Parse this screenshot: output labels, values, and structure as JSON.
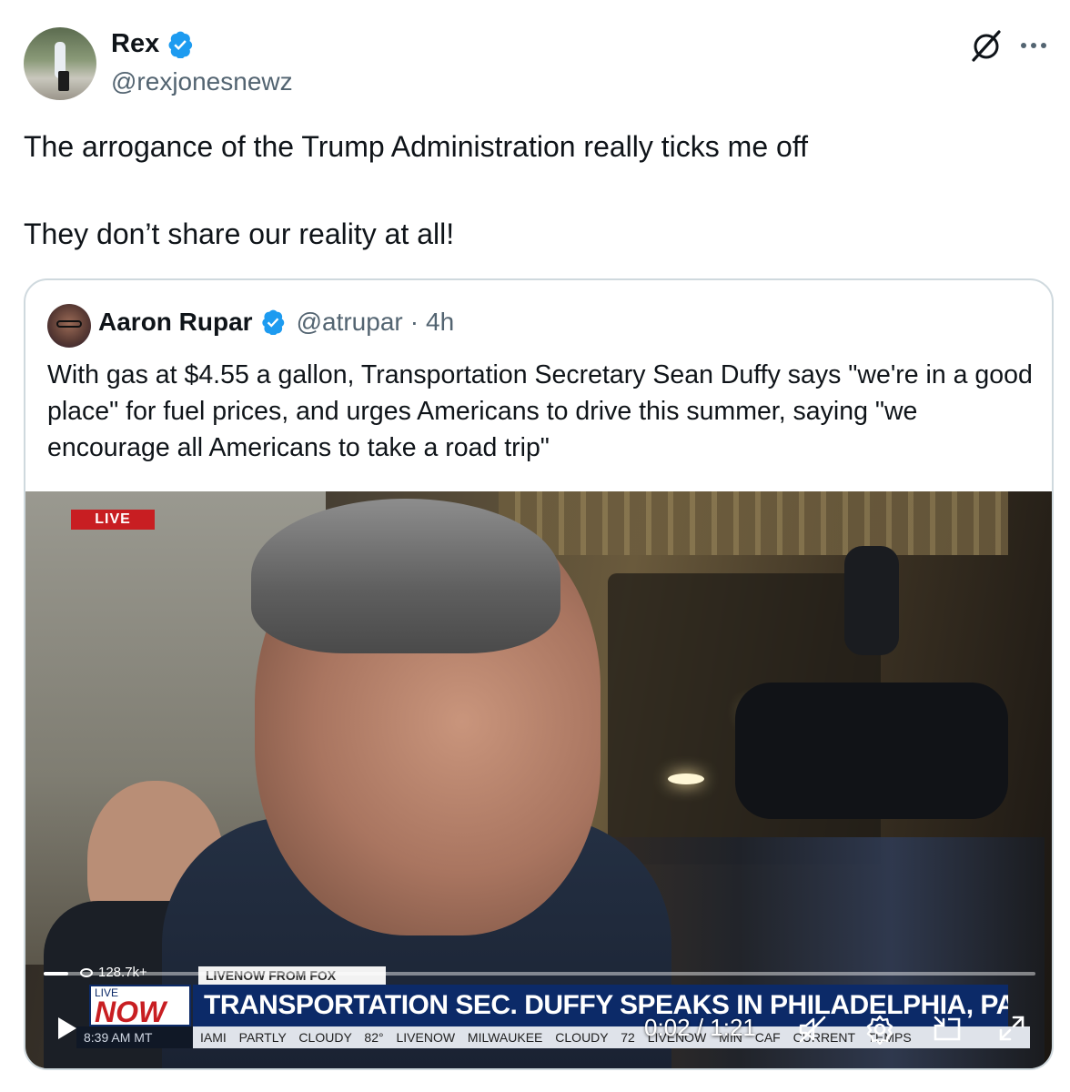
{
  "author": {
    "display_name": "Rex",
    "handle": "@rexjonesnewz",
    "verified_icon": "verified-badge-icon"
  },
  "tweet": {
    "lines": [
      "The arrogance of the Trump Administration really ticks me off",
      "They don’t share our reality at all!"
    ]
  },
  "header_icons": [
    "grok-icon",
    "more-icon"
  ],
  "quoted": {
    "display_name": "Aaron Rupar",
    "handle": "@atrupar",
    "separator": "·",
    "time": "4h",
    "text": "With gas at $4.55 a gallon, Transportation Secretary Sean Duffy says \"we're in a good place\" for fuel prices, and urges Americans to drive this summer, saying \"we encourage all Americans to take a road trip\""
  },
  "video": {
    "live_badge": "LIVE",
    "views": "128.7k+",
    "chyron_top": "LIVENOW FROM FOX",
    "live_small": "LIVE",
    "live_now": "NOW",
    "headline": "TRANSPORTATION SEC. DUFFY SPEAKS IN PHILADELPHIA, PA",
    "clock": "8:39 AM MT",
    "ticker": "IAMI PARTLY CLOUDY 82° LIVENOW MILWAUKEE CLOUDY 72 LIVENOW MIN CAF CURRENT TEMPS",
    "timecode": "0:02 / 1:21",
    "progress_fraction": 0.025,
    "controls": [
      "play-icon",
      "mute-icon",
      "gear-icon",
      "pip-icon",
      "expand-icon"
    ]
  },
  "colors": {
    "verified_blue": "#1d9bf0",
    "text_primary": "#0f1419",
    "text_secondary": "#536471",
    "border": "#cfd9de",
    "chyron_navy": "#0c2a68",
    "live_red": "#c81e22"
  }
}
